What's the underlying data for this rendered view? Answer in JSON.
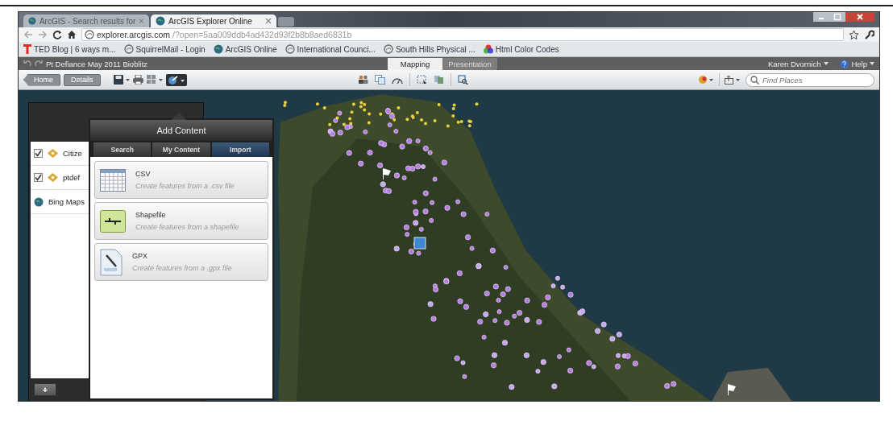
{
  "browser_tabs": [
    {
      "label": "ArcGIS - Search results for",
      "selected": false
    },
    {
      "label": "ArcGIS Explorer Online",
      "selected": true
    }
  ],
  "address_bar": {
    "host": "explorer.arcgis.com",
    "path": "/?open=5aa009ddb4ad432d93f2b8b8aed6831b"
  },
  "bookmarks": [
    {
      "label": "TED Blog | 6 ways m...",
      "kind": "ted"
    },
    {
      "label": "SquirrelMail - Login",
      "kind": "page"
    },
    {
      "label": "ArcGIS Online",
      "kind": "globe"
    },
    {
      "label": "International Counci...",
      "kind": "page"
    },
    {
      "label": "South Hills Physical ...",
      "kind": "page"
    },
    {
      "label": "Html Color Codes",
      "kind": "colors"
    }
  ],
  "app": {
    "title": "Pt Defiance May 2011 Bioblitz",
    "user": "Karen Dvornich",
    "help": "Help",
    "view_tabs": [
      {
        "label": "Mapping",
        "selected": true
      },
      {
        "label": "Presentation",
        "selected": false
      }
    ]
  },
  "toolbar": {
    "buttons": [
      "Home",
      "Details"
    ],
    "search": {
      "placeholder": "Find Places"
    }
  },
  "layers": [
    {
      "name": "Citize",
      "kind": "feature",
      "checked": true
    },
    {
      "name": "ptdef",
      "kind": "feature",
      "checked": true
    },
    {
      "name": "Bing Maps",
      "kind": "basemap"
    }
  ],
  "layer_panel": {
    "add_button": "+"
  },
  "add_content": {
    "title": "Add Content",
    "tabs": [
      {
        "label": "Search",
        "selected": false
      },
      {
        "label": "My Content",
        "selected": false
      },
      {
        "label": "Import",
        "selected": true
      }
    ],
    "items": [
      {
        "kind": "csv",
        "title": "CSV",
        "description": "Create features from a .csv file"
      },
      {
        "kind": "shapefile",
        "title": "Shapefile",
        "description": "Create features from a shapefile"
      },
      {
        "kind": "gpx",
        "title": "GPX",
        "description": "Create features from a .gpx file"
      }
    ]
  }
}
